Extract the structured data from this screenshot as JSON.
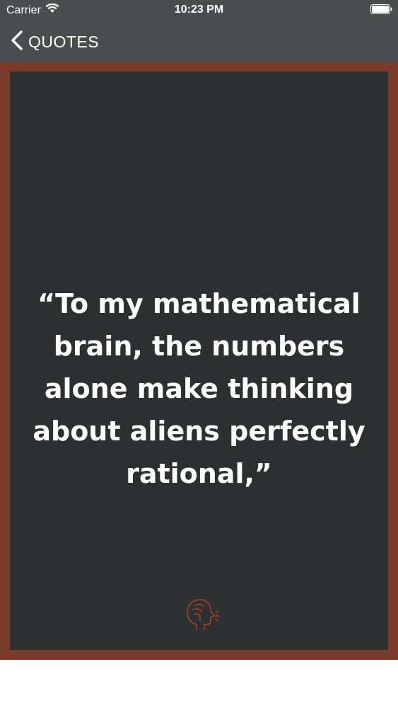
{
  "status_bar": {
    "carrier": "Carrier",
    "time": "10:23 PM"
  },
  "nav": {
    "back_label": "QUOTES"
  },
  "quote": {
    "text": "“To my mathematical brain, the numbers alone make thinking about aliens perfectly rational,”"
  },
  "icons": {
    "back": "chevron-left-icon",
    "wifi": "wifi-icon",
    "battery": "battery-icon",
    "author": "speaking-head-icon"
  },
  "colors": {
    "nav_bg": "#4a4d4e",
    "frame": "#7a3b2b",
    "card_bg": "#2c3031",
    "icon_accent": "#8a3e2c"
  }
}
